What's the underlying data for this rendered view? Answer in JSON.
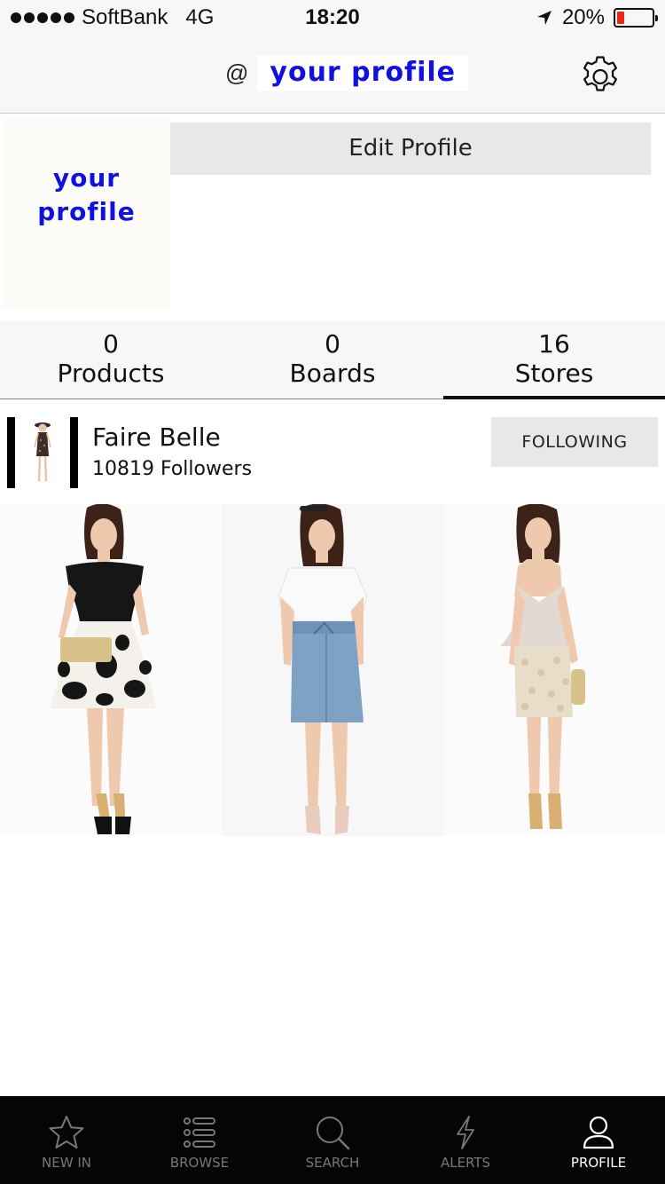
{
  "status_bar": {
    "carrier": "SoftBank",
    "network": "4G",
    "time": "18:20",
    "battery_percent": "20%",
    "battery_level": 0.2
  },
  "nav": {
    "at_symbol": "@",
    "username": "your profile",
    "settings_icon": "gear-icon"
  },
  "profile": {
    "avatar_text_line1": "your",
    "avatar_text_line2": "profile",
    "edit_label": "Edit Profile"
  },
  "stats": [
    {
      "count": "0",
      "label": "Products"
    },
    {
      "count": "0",
      "label": "Boards"
    },
    {
      "count": "16",
      "label": "Stores"
    }
  ],
  "active_stat": "Stores",
  "store": {
    "name": "Faire Belle",
    "followers": "10819 Followers",
    "follow_label": "FOLLOWING"
  },
  "tabs": [
    {
      "label": "NEW IN",
      "icon": "star-icon"
    },
    {
      "label": "BROWSE",
      "icon": "list-icon"
    },
    {
      "label": "SEARCH",
      "icon": "search-icon"
    },
    {
      "label": "ALERTS",
      "icon": "lightning-icon"
    },
    {
      "label": "PROFILE",
      "icon": "person-icon"
    }
  ],
  "active_tab": "PROFILE",
  "colors": {
    "profile_text_blue": "#1010e0",
    "battery_red": "#e8261c",
    "tabbar_bg": "#050505"
  }
}
